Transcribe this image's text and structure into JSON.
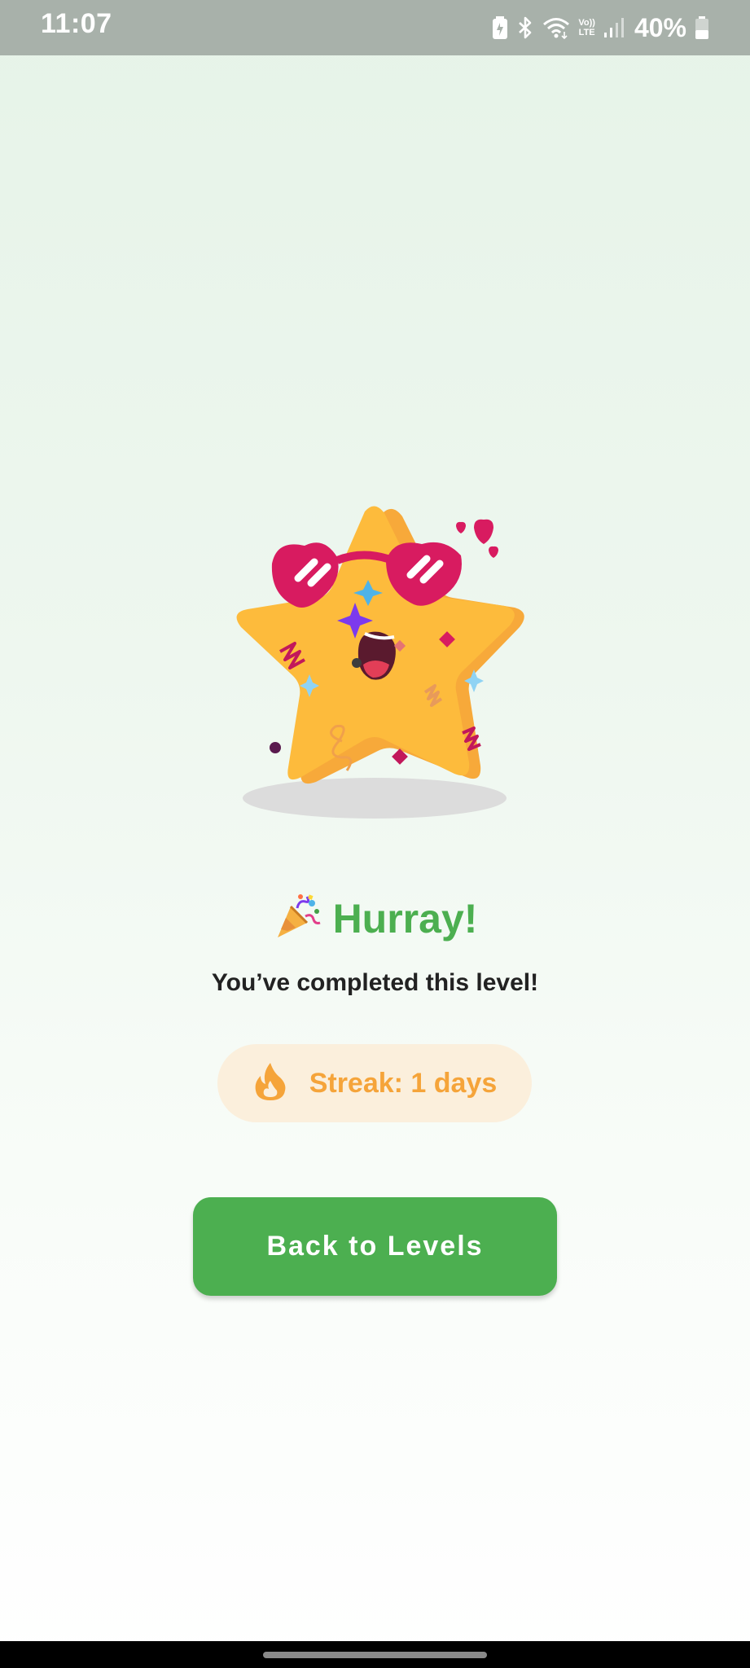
{
  "status_bar": {
    "time": "11:07",
    "battery_percent": "40%",
    "volte_line1": "Vo))",
    "volte_line2": "LTE",
    "icons": [
      "battery-saver-icon",
      "bluetooth-icon",
      "wifi-icon",
      "volte-icon",
      "signal-icon",
      "battery-icon"
    ]
  },
  "completion": {
    "mascot": "star-mascot-with-heart-sunglasses",
    "title_emoji": "🎉",
    "title": "Hurray!",
    "message": "You’ve completed this level!"
  },
  "streak": {
    "icon": "fire-icon",
    "label": "Streak: 1 days"
  },
  "actions": {
    "back_label": "Back to Levels"
  },
  "colors": {
    "primary_green": "#4caf50",
    "streak_orange": "#f5a43a",
    "streak_pill_bg": "#fbefdc",
    "status_bar_bg": "#a8b1aa",
    "star_yellow": "#fdbb3c",
    "glasses_pink": "#d81b60"
  }
}
